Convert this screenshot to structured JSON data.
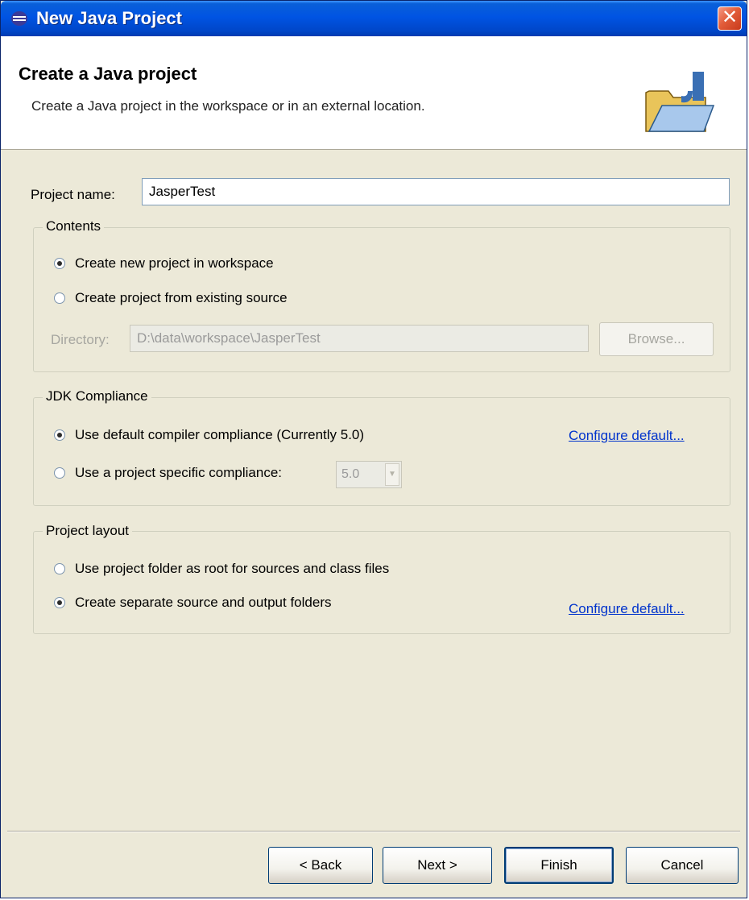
{
  "window": {
    "title": "New Java Project",
    "close_label": "✕"
  },
  "banner": {
    "title": "Create a Java project",
    "description": "Create a Java project in the workspace or in an external location."
  },
  "project_name": {
    "label": "Project name:",
    "value": "JasperTest"
  },
  "contents": {
    "legend": "Contents",
    "option_workspace": "Create new project in workspace",
    "option_existing": "Create project from existing source",
    "directory_label": "Directory:",
    "directory_value": "D:\\data\\workspace\\JasperTest",
    "browse_label": "Browse...",
    "selected": "workspace"
  },
  "jdk": {
    "legend": "JDK Compliance",
    "option_default": "Use default compiler compliance (Currently 5.0)",
    "option_specific": "Use a project specific compliance:",
    "compliance_value": "5.0",
    "configure_link": "Configure default...",
    "selected": "default"
  },
  "layout": {
    "legend": "Project layout",
    "option_root": "Use project folder as root for sources and class files",
    "option_separate": "Create separate source and output folders",
    "configure_link": "Configure default...",
    "selected": "separate"
  },
  "buttons": {
    "back": "< Back",
    "next": "Next >",
    "finish": "Finish",
    "cancel": "Cancel"
  },
  "colors": {
    "titlebar": "#0054e3",
    "dialog_bg": "#ece9d8",
    "link": "#0033cc",
    "close": "#e25d3a"
  }
}
